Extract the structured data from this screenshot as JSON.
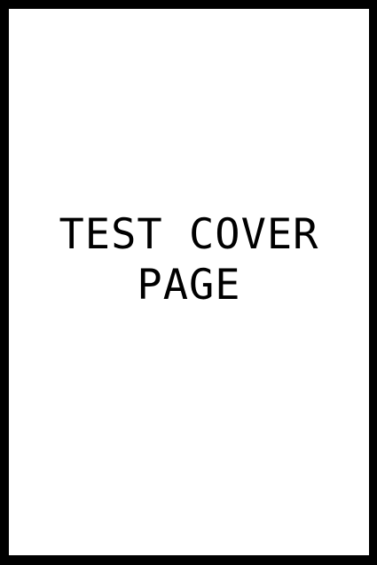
{
  "cover": {
    "title_line_1": "TEST COVER",
    "title_line_2": "PAGE"
  },
  "colors": {
    "frame": "#000000",
    "page": "#ffffff",
    "text": "#000000"
  }
}
